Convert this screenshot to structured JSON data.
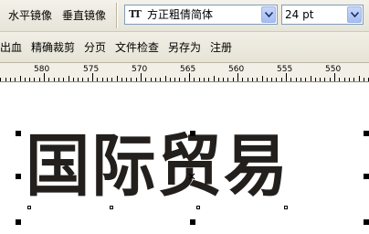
{
  "toolbar": {
    "mirror_horizontal": "水平镜像",
    "mirror_vertical": "垂直镜像",
    "font_name": "方正粗倩简体",
    "font_size": "24 pt"
  },
  "menu": {
    "items": [
      "出血",
      "精确裁剪",
      "分页",
      "文件检查",
      "另存为",
      "注册"
    ]
  },
  "ruler": {
    "labels": [
      "580",
      "575",
      "570",
      "565",
      "560",
      "555",
      "550"
    ]
  },
  "canvas": {
    "text": "国际贸易"
  },
  "colors": {
    "accent_blue": "#7f9db9",
    "text_fill": "#231f1c"
  }
}
